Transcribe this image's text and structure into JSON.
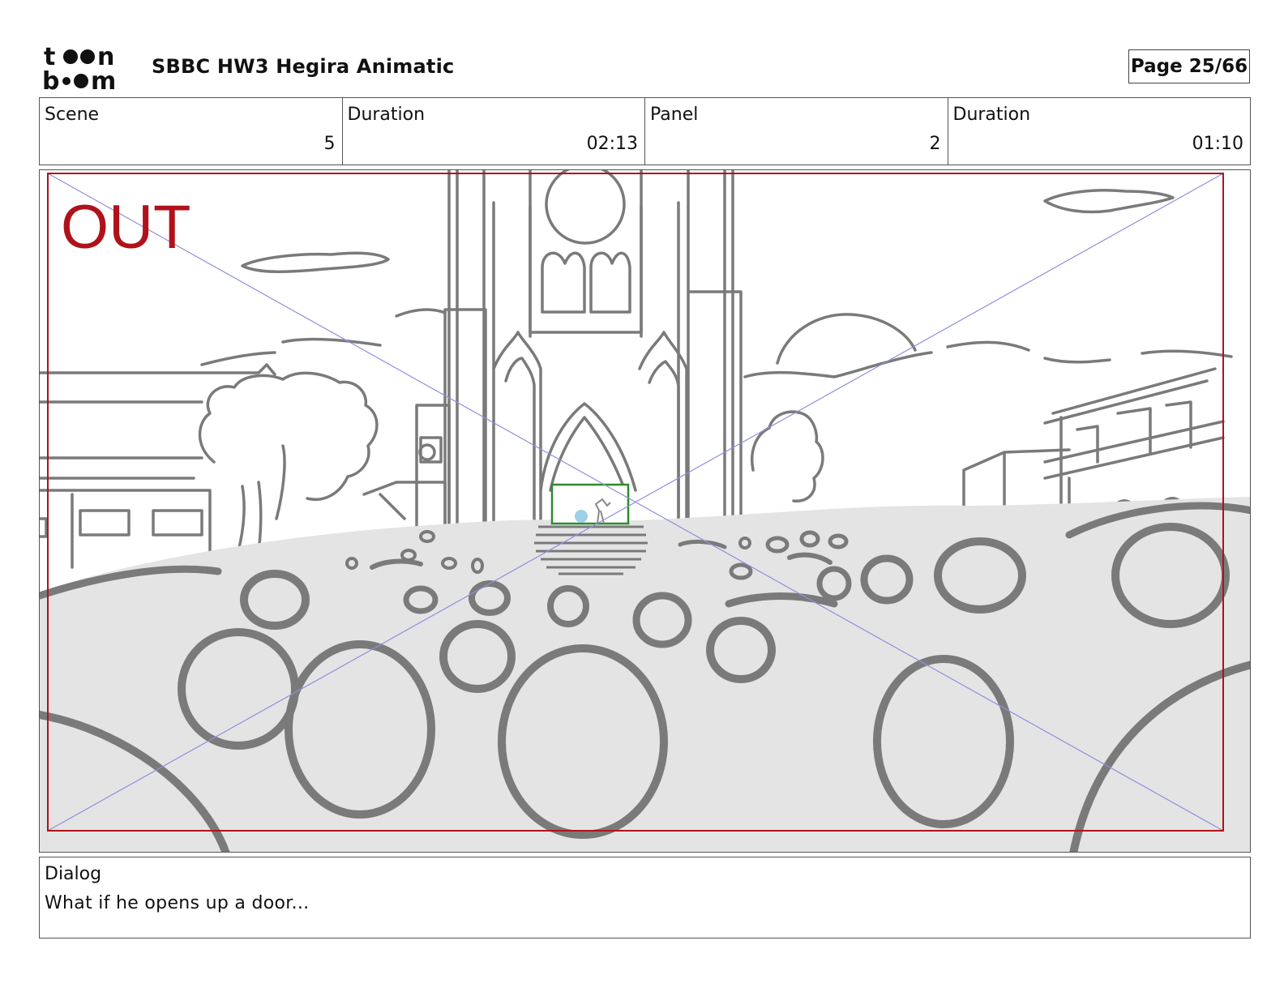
{
  "header": {
    "logo_text": "toon boom",
    "title": "SBBC HW3 Hegira Animatic",
    "page": "Page 25/66"
  },
  "info": [
    {
      "label": "Scene",
      "value": "5"
    },
    {
      "label": "Duration",
      "value": "02:13"
    },
    {
      "label": "Panel",
      "value": "2"
    },
    {
      "label": "Duration",
      "value": "01:10"
    }
  ],
  "panel": {
    "safe_area_label": "OUT",
    "colors": {
      "safe_area": "#b0121b",
      "guides": "#8f8fe0",
      "sketch": "#7a7a7a",
      "crowd_fill": "#e4e4e4",
      "door_frame": "#2e8b2e",
      "figure": "#9ccfe8"
    }
  },
  "dialog": {
    "label": "Dialog",
    "text": "What if he opens up a door..."
  }
}
